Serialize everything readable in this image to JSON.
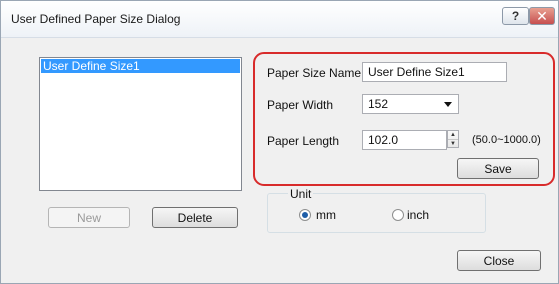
{
  "window": {
    "title": "User Defined Paper Size Dialog",
    "help_glyph": "?",
    "close_glyph": "✕"
  },
  "list": {
    "items": [
      "User Define Size1"
    ],
    "selected_index": 0
  },
  "buttons": {
    "new": "New",
    "delete": "Delete",
    "save": "Save",
    "close": "Close"
  },
  "form": {
    "name_label": "Paper Size Name",
    "name_value": "User Define Size1",
    "width_label": "Paper Width",
    "width_value": "152",
    "length_label": "Paper Length",
    "length_value": "102.0",
    "length_range": "(50.0~1000.0)"
  },
  "unit": {
    "legend": "Unit",
    "options": [
      "mm",
      "inch"
    ],
    "selected": "mm"
  },
  "colors": {
    "highlight_box": "#d82b2b",
    "selection": "#3399ff"
  },
  "icons": {
    "width_dropdown": "dropdown-arrow-icon",
    "length_spinner": "spinner-icon"
  }
}
